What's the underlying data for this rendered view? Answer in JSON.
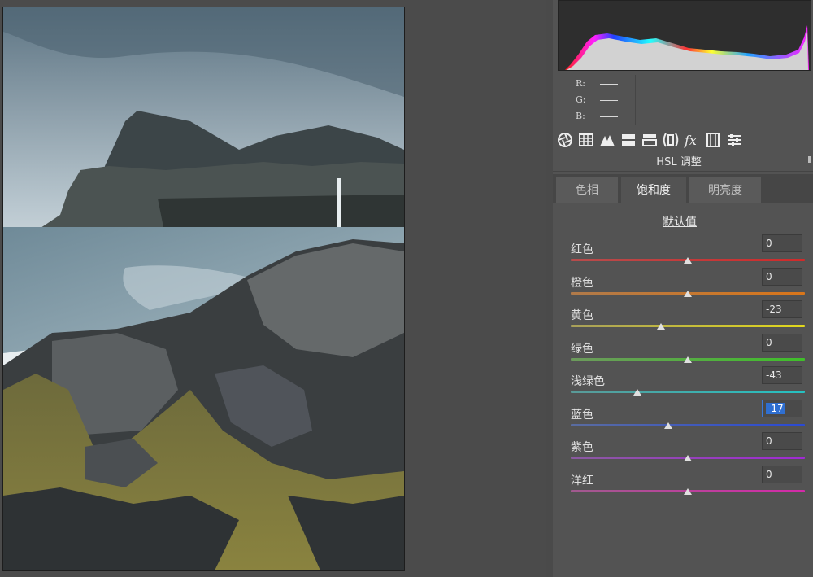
{
  "rgb_readout": [
    {
      "label": "R:"
    },
    {
      "label": "G:"
    },
    {
      "label": "B:"
    }
  ],
  "toolbar": {
    "icons": [
      "aperture-icon",
      "grid-icon",
      "mountain-icon",
      "hsl-icon",
      "split-tone-icon",
      "lens-icon",
      "fx-icon",
      "film-icon",
      "sliders-icon"
    ]
  },
  "panel": {
    "title": "HSL 调整",
    "reset": "默认值"
  },
  "tabs": [
    {
      "label": "色相",
      "active": false
    },
    {
      "label": "饱和度",
      "active": true
    },
    {
      "label": "明亮度",
      "active": false
    }
  ],
  "sliders": [
    {
      "label": "红色",
      "value": "0",
      "numeric": 0,
      "color_a": "#b64c4c",
      "color_b": "#d02a2a"
    },
    {
      "label": "橙色",
      "value": "0",
      "numeric": 0,
      "color_a": "#b07a4a",
      "color_b": "#d9761a"
    },
    {
      "label": "黄色",
      "value": "-23",
      "numeric": -23,
      "color_a": "#a8a05a",
      "color_b": "#e2d81c"
    },
    {
      "label": "绿色",
      "value": "0",
      "numeric": 0,
      "color_a": "#6c9a5c",
      "color_b": "#3fbf2a"
    },
    {
      "label": "浅绿色",
      "value": "-43",
      "numeric": -43,
      "color_a": "#5a9a98",
      "color_b": "#25c2c2"
    },
    {
      "label": "蓝色",
      "value": "-17",
      "numeric": -17,
      "color_a": "#5a6ca0",
      "color_b": "#2a4ad4",
      "focused": true
    },
    {
      "label": "紫色",
      "value": "0",
      "numeric": 0,
      "color_a": "#8a5aa0",
      "color_b": "#a02ad4"
    },
    {
      "label": "洋红",
      "value": "0",
      "numeric": 0,
      "color_a": "#a05a8e",
      "color_b": "#d42aa8"
    }
  ],
  "slider_range": [
    -100,
    100
  ]
}
